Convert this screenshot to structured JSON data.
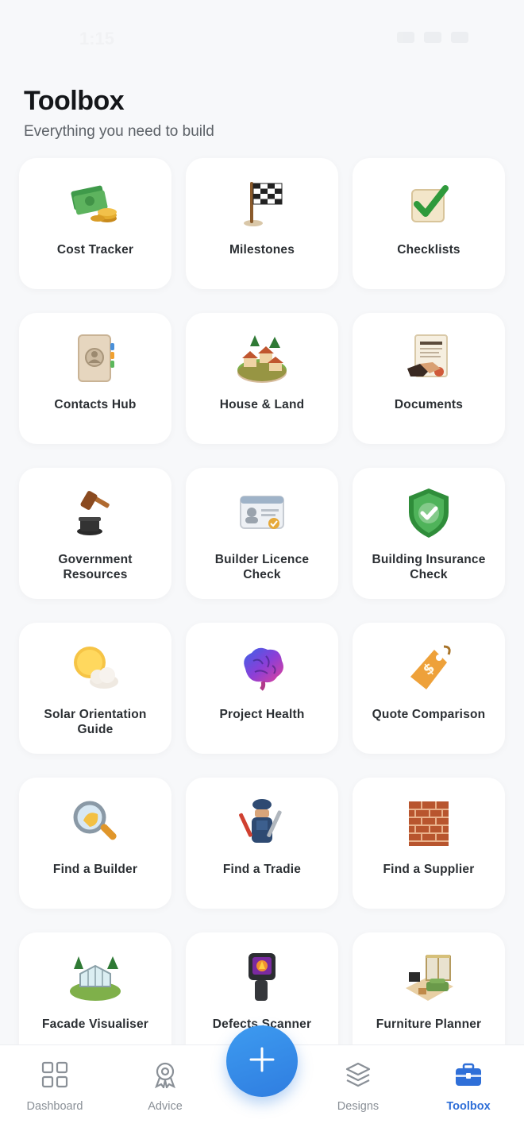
{
  "status_bar": {
    "time": "1:15"
  },
  "header": {
    "title": "Toolbox",
    "subtitle": "Everything you need to build"
  },
  "tools": [
    {
      "label": "Cost Tracker",
      "icon": "money-coins-icon"
    },
    {
      "label": "Milestones",
      "icon": "checkered-flag-icon"
    },
    {
      "label": "Checklists",
      "icon": "checklist-icon"
    },
    {
      "label": "Contacts Hub",
      "icon": "address-book-icon"
    },
    {
      "label": "House & Land",
      "icon": "house-land-icon"
    },
    {
      "label": "Documents",
      "icon": "contract-handshake-icon"
    },
    {
      "label": "Government Resources",
      "icon": "gavel-icon"
    },
    {
      "label": "Builder Licence Check",
      "icon": "id-card-icon"
    },
    {
      "label": "Building Insurance Check",
      "icon": "shield-check-icon"
    },
    {
      "label": "Solar Orientation Guide",
      "icon": "sun-cloud-icon"
    },
    {
      "label": "Project Health",
      "icon": "brain-icon"
    },
    {
      "label": "Quote Comparison",
      "icon": "price-tag-icon"
    },
    {
      "label": "Find a Builder",
      "icon": "magnifier-icon"
    },
    {
      "label": "Find a Tradie",
      "icon": "tradie-tools-icon"
    },
    {
      "label": "Find a Supplier",
      "icon": "brick-wall-icon"
    },
    {
      "label": "Facade Visualiser",
      "icon": "greenhouse-icon"
    },
    {
      "label": "Defects Scanner",
      "icon": "thermal-camera-icon"
    },
    {
      "label": "Furniture Planner",
      "icon": "living-room-icon"
    }
  ],
  "nav": {
    "dashboard": "Dashboard",
    "advice": "Advice",
    "designs": "Designs",
    "toolbox": "Toolbox"
  },
  "colors": {
    "accent": "#2f6fd8",
    "fab": "#3a8ded",
    "background": "#f7f8fa"
  }
}
